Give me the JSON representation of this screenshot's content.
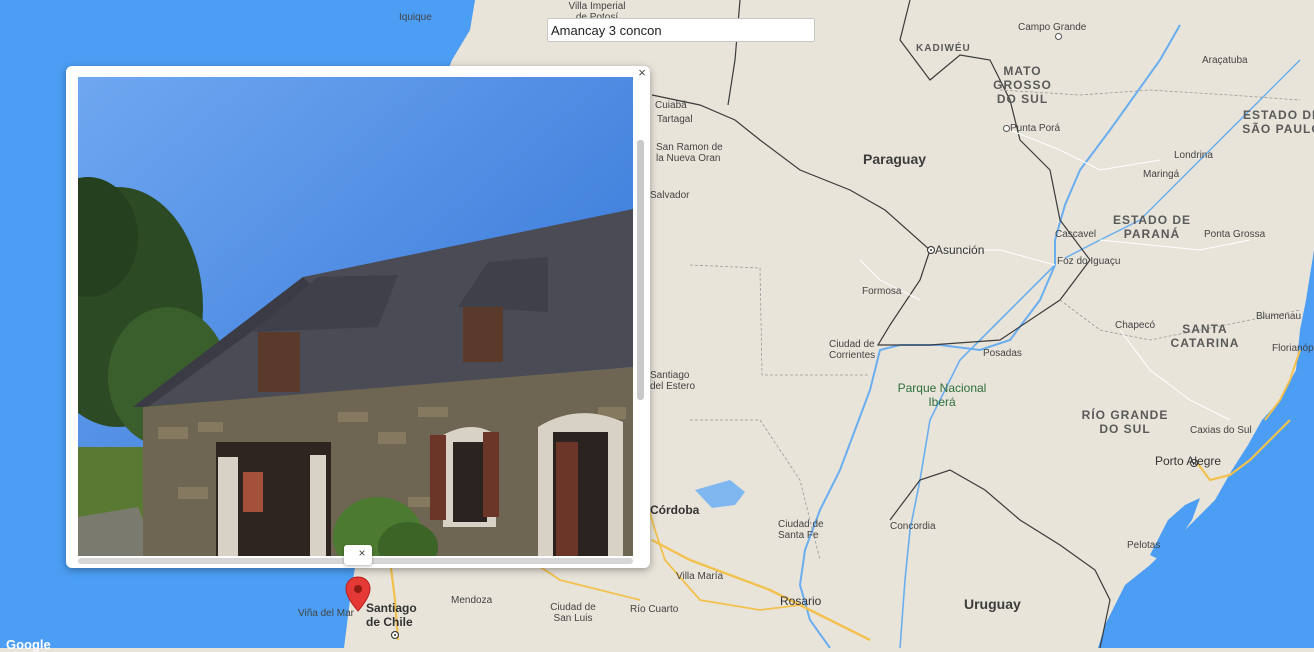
{
  "search": {
    "value": "Amancay 3 concon"
  },
  "popup": {
    "close_glyph": "×"
  },
  "marker_info": {
    "close_glyph": "×"
  },
  "attribution": {
    "logo_text": "Google"
  },
  "map": {
    "countries": [
      "Paraguay",
      "Uruguay"
    ],
    "regions": [
      "KADIWÉU",
      "MATO GROSSO DO SUL",
      "ESTADO DE SÃO PAULO",
      "ESTADO DE PARANÁ",
      "SANTA CATARINA",
      "RÍO GRANDE DO SUL"
    ],
    "parks": [
      "Parque Nacional Iberá"
    ],
    "cities": [
      "Iquique",
      "Villa Imperial de Potosí",
      "Campo Grande",
      "Araçatuba",
      "Cuiabá",
      "Tartagal",
      "San Ramon de la Nueva Oran",
      "Salvador",
      "Punta Porá",
      "Londrina",
      "Maringá",
      "Asunción",
      "Cascavel",
      "Ponta Grossa",
      "Foz do Iguaçu",
      "Formosa",
      "Chapecó",
      "Blumenau",
      "Florianópolis",
      "Ciudad de Corrientes",
      "Posadas",
      "Santiago del Estero",
      "Caxias do Sul",
      "Porto Alegre",
      "Ciudad de Santa Fe",
      "Concordia",
      "Pelotas",
      "Córdoba",
      "Villa María",
      "Rosario",
      "Río Cuarto",
      "Ciudad de San Luis",
      "Mendoza",
      "Viña del Mar",
      "Santiago de Chile"
    ]
  },
  "colors": {
    "ocean": "#4b9ef4",
    "land": "#e8e4da",
    "road": "#f2c14e",
    "marker": "#e53935"
  },
  "icons": {
    "popup_close": "close-icon",
    "marker_close": "close-icon",
    "marker": "map-pin-icon"
  }
}
